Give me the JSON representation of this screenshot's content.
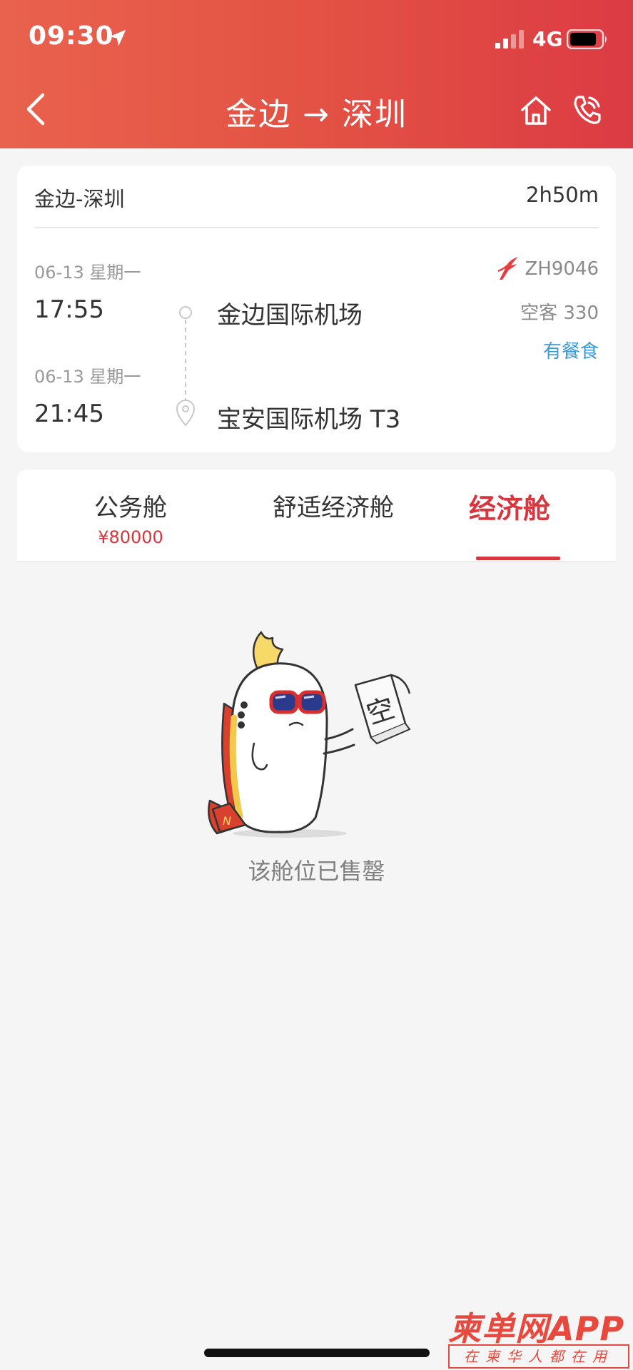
{
  "status_bar": {
    "time": "09:30",
    "network": "4G"
  },
  "nav": {
    "title": "金边 → 深圳"
  },
  "flight": {
    "route": "金边-深圳",
    "duration": "2h50m",
    "departure": {
      "date": "06-13 星期一",
      "time": "17:55",
      "airport": "金边国际机场"
    },
    "arrival": {
      "date": "06-13 星期一",
      "time": "21:45",
      "airport": "宝安国际机场 T3"
    },
    "flight_number": "ZH9046",
    "aircraft": "空客 330",
    "meal": "有餐食"
  },
  "tabs": [
    {
      "label": "公务舱",
      "price": "¥80000"
    },
    {
      "label": "舒适经济舱"
    },
    {
      "label": "经济舱"
    }
  ],
  "empty_state": {
    "sign_text": "空",
    "message": "该舱位已售罄"
  },
  "watermark": {
    "title": "柬单网APP",
    "subtitle": "在柬华人都在用"
  },
  "colors": {
    "header_gradient_start": "#e9624d",
    "header_gradient_end": "#dc3b44",
    "accent_red": "#d7363e",
    "meal_blue": "#3a9ad9",
    "background": "#f5f5f5"
  }
}
